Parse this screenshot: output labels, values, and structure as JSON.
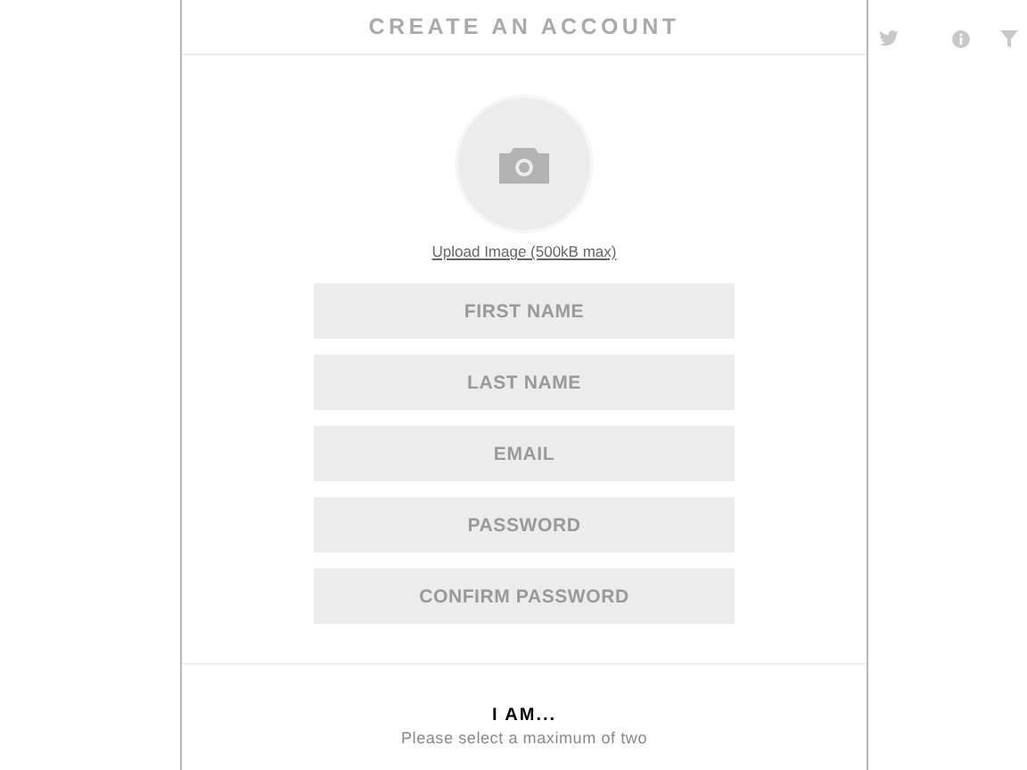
{
  "title": "CREATE AN ACCOUNT",
  "upload_link": "Upload Image (500kB max)",
  "fields": [
    {
      "placeholder": "FIRST NAME"
    },
    {
      "placeholder": "LAST NAME"
    },
    {
      "placeholder": "EMAIL"
    },
    {
      "placeholder": "PASSWORD"
    },
    {
      "placeholder": "CONFIRM PASSWORD"
    }
  ],
  "role_section": {
    "heading": "I AM...",
    "hint": "Please select a maximum of two"
  }
}
